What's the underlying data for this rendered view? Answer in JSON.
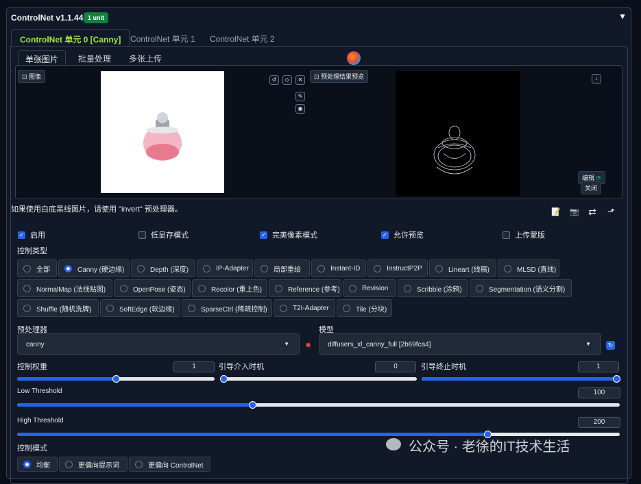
{
  "header": {
    "title": "ControlNet v1.1.445",
    "badge": "1 unit"
  },
  "unit_tabs": [
    "ControlNet 单元 0 [Canny]",
    "ControlNet 单元 1",
    "ControlNet 单元 2"
  ],
  "input_tabs": [
    "单张图片",
    "批量处理",
    "多张上传"
  ],
  "image_panel": {
    "input_label": "图像",
    "preview_label": "预处理结果预览",
    "edit_button": "编辑",
    "close_button": "关闭"
  },
  "invert_note": "如果使用白底黑线图片，请使用 \"invert\" 预处理器。",
  "checkboxes": [
    {
      "label": "启用",
      "checked": true
    },
    {
      "label": "低显存模式",
      "checked": false
    },
    {
      "label": "完美像素模式",
      "checked": true
    },
    {
      "label": "允许预览",
      "checked": true
    },
    {
      "label": "上传蒙版",
      "checked": false
    }
  ],
  "control_type": {
    "label": "控制类型",
    "options": [
      "全部",
      "Canny (硬边缘)",
      "Depth (深度)",
      "IP-Adapter",
      "局部重绘",
      "Instant-ID",
      "InstructP2P",
      "Lineart (线稿)",
      "MLSD (直线)",
      "NormalMap (法线贴图)",
      "OpenPose (姿态)",
      "Recolor (重上色)",
      "Reference (参考)",
      "Revision",
      "Scribble (涂鸦)",
      "Segmentation (语义分割)",
      "Shuffle (随机洗牌)",
      "SoftEdge (软边缘)",
      "SparseCtrl (稀疏控制)",
      "T2I-Adapter",
      "Tile (分块)"
    ],
    "selected": "Canny (硬边缘)"
  },
  "preprocessor": {
    "label": "预处理器",
    "value": "canny"
  },
  "model": {
    "label": "模型",
    "value": "diffusers_xl_canny_full [2b69fca4]"
  },
  "control_weight": {
    "label": "控制权重",
    "value": "1",
    "fraction": 0.5
  },
  "start_step": {
    "label": "引导介入时机",
    "value": "0",
    "fraction": 0.0
  },
  "end_step": {
    "label": "引导终止时机",
    "value": "1",
    "fraction": 1.0
  },
  "low_threshold": {
    "label": "Low Threshold",
    "value": "100",
    "fraction": 0.39
  },
  "high_threshold": {
    "label": "High Threshold",
    "value": "200",
    "fraction": 0.78
  },
  "control_mode": {
    "label": "控制模式",
    "options": [
      "均衡",
      "更偏向提示词",
      "更偏向 ControlNet"
    ],
    "selected": "均衡"
  },
  "watermark": "公众号 · 老徐的IT技术生活",
  "colors": {
    "accent": "#2563eb",
    "badge": "#15803d",
    "active_tab": "#a3e635"
  }
}
